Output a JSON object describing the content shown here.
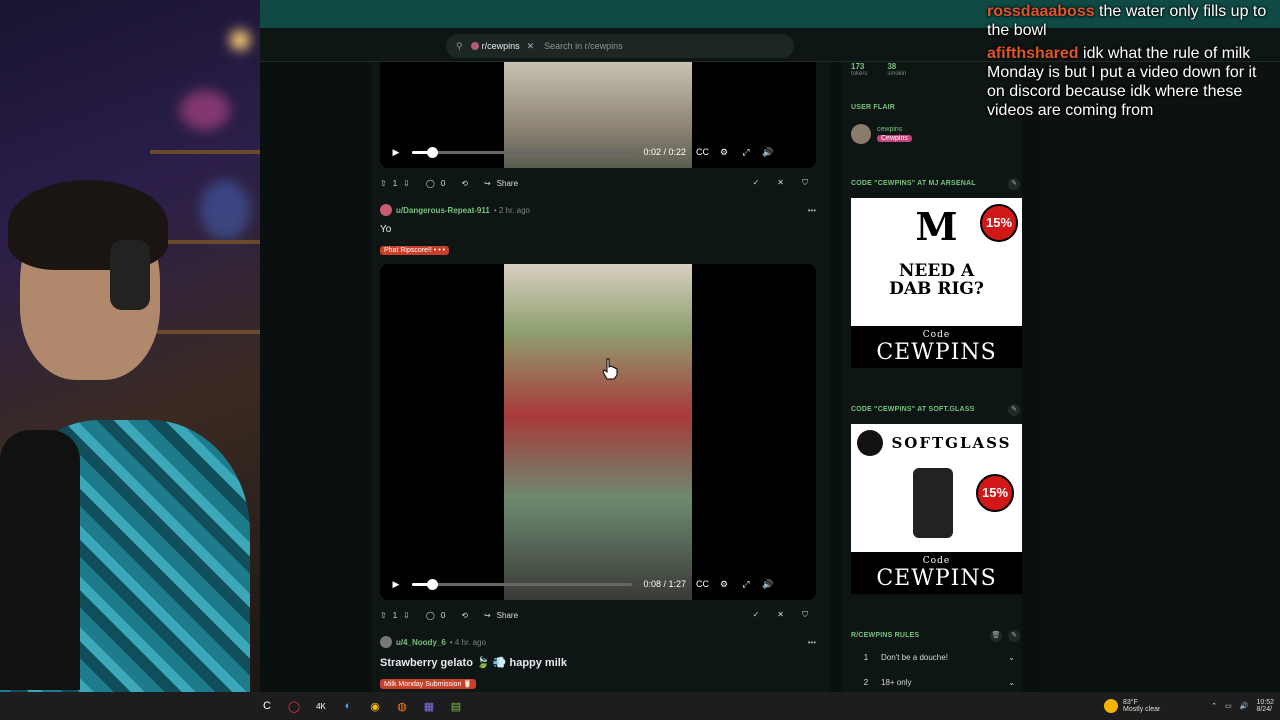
{
  "header": {
    "search_chip": "r/cewpins",
    "search_placeholder": "Search in r/cewpins"
  },
  "posts": [
    {
      "video": {
        "time": "0:02 / 0:22",
        "progress": 0.09
      },
      "actions": {
        "votes": "1",
        "comments": "0",
        "share": "Share"
      }
    },
    {
      "user": "u/Dangerous-Repeat-911",
      "ago": "• 2 hr. ago",
      "title": "Yo",
      "flair": "Phat Ripscore!! • • •",
      "video": {
        "time": "0:08 / 1:27",
        "progress": 0.09
      },
      "actions": {
        "votes": "1",
        "comments": "0",
        "share": "Share"
      }
    },
    {
      "user": "u/4_Noody_6",
      "ago": "• 4 hr. ago",
      "title": "Strawberry gelato 🍃 💨 happy milk",
      "flair": "Milk Monday Submission 🥛"
    }
  ],
  "sidebar": {
    "stats": [
      {
        "number": "173",
        "label": "tokers"
      },
      {
        "number": "38",
        "label": "smokin"
      }
    ],
    "user_flair_title": "USER FLAIR",
    "user_flair_name": "cewpins",
    "user_flair_tag": "Cewpins",
    "ad1_title": "CODE \"CEWPINS\" AT MJ ARSENAL",
    "ad1_headline": "NEED A DAB RIG?",
    "ad1_badge": "15%",
    "ad1_code_label": "Code",
    "ad1_code": "CEWPINS",
    "ad2_title": "CODE \"CEWPINS\" AT SOFT.GLASS",
    "ad2_brand": "SOFTGLASS",
    "ad2_badge": "15%",
    "ad2_code_label": "Code",
    "ad2_code": "CEWPINS",
    "rules_title": "R/CEWPINS RULES",
    "rules": [
      {
        "num": "1",
        "text": "Don't be a douche!"
      },
      {
        "num": "2",
        "text": "18+ only"
      }
    ]
  },
  "chat": [
    {
      "user": "rossdaaaboss",
      "text": " the water only fills up to the bowl"
    },
    {
      "user": "afifthshared",
      "text": " idk what the rule of milk Monday is but I put a video down for it on discord because idk where these videos are coming from"
    }
  ],
  "taskbar": {
    "weather_temp": "83°F",
    "weather_desc": "Mostly clear",
    "time": "10:52",
    "date": "8/24/"
  }
}
